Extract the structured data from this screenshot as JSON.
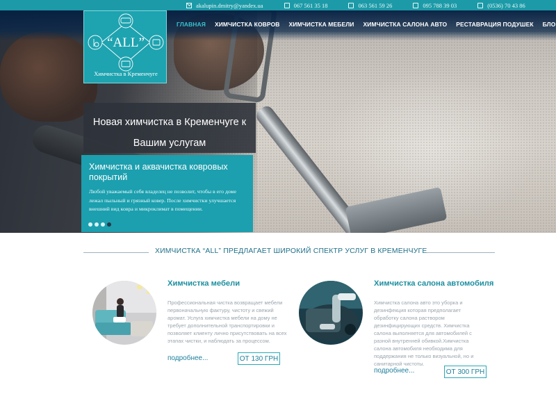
{
  "contacts": {
    "email": "akalupin.dmitry@yandex.ua",
    "phones": [
      "067 561 35 18",
      "063 561 59 26",
      "095 788 39 03",
      "(0536) 70 43 86"
    ],
    "icons": [
      "mail-icon",
      "phone-icon"
    ]
  },
  "logo": {
    "name": "“ALL”",
    "subtitle": "Химчистка в Кременчуге"
  },
  "nav": {
    "items": [
      "ГЛАВНАЯ",
      "ХИМЧИСТКА КОВРОВ",
      "ХИМЧИСТКА МЕБЕЛИ",
      "ХИМЧИСТКА САЛОНА АВТО",
      "РЕСТАВРАЦИЯ ПОДУШЕК",
      "БЛОГ"
    ],
    "active_index": 0
  },
  "hero": {
    "title_line1": "Новая химчистка в Кременчуге к",
    "title_line2": "Вашим услугам",
    "slide_heading": "Химчистка и аквачистка ковровых покрытий",
    "slide_text": "Любой уважаемый себя владелец не позволит, чтобы в его доме лежал пыльный и грязный ковер. После химчистки улучшается внешний вид ковра и микроклимат в помещении.",
    "slides_count": 4,
    "active_slide": 3
  },
  "section": {
    "title": "ХИМЧИСТКА “ALL” ПРЕДЛАГАЕТ ШИРОКИЙ СПЕКТР УСЛУГ В КРЕМЕНЧУГЕ"
  },
  "services": [
    {
      "title": "Химчистка мебели",
      "description": "Профессиональная чистка возвращает мебели первоначальную фактуру, чистоту и свежий аромат. Услуга химчистка мебели на дому не требует дополнительной транспортировки и позволяет клиенту лично присутствовать на всех этапах чистки, и наблюдать за процессом.",
      "more_label": "подробнее...",
      "price": "ОТ 130 ГРН"
    },
    {
      "title": "Химчистка салона автомобиля",
      "description": "Химчистка салона авто это уборка и дезинфекция которая предполагает обработку салона раствором дезинфицирующих средств. Химчистка салона выполняется для автомобилей с разной внутренней обивкой.Химчистка салона автомобиля необходима для поддержания не только визуальной, но и санитарной чистоты.",
      "more_label": "подробнее...",
      "price": "ОТ 300 ГРН"
    }
  ],
  "colors": {
    "accent": "#1c9fae",
    "topbar": "#1d9aa7",
    "nav_active": "#38c2cf",
    "title_text": "#1c8fa0"
  }
}
